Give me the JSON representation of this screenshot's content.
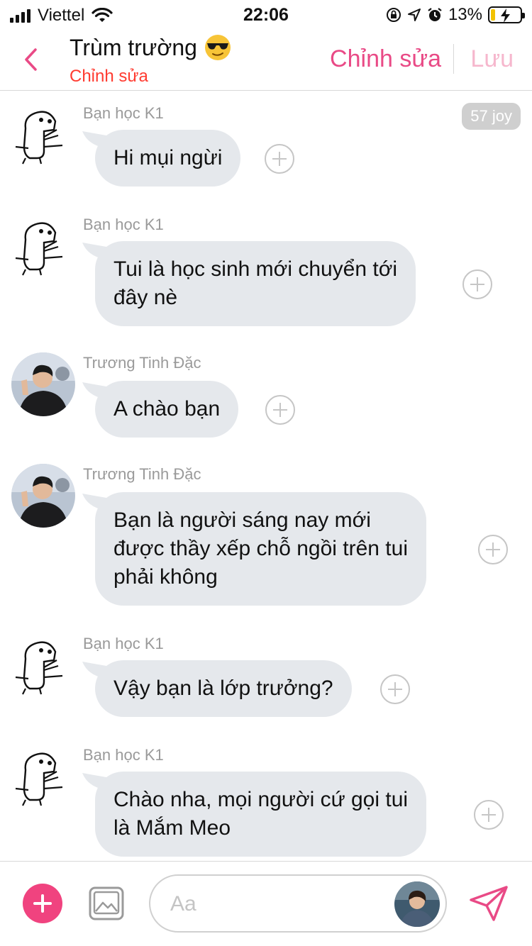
{
  "status_bar": {
    "carrier": "Viettel",
    "time": "22:06",
    "battery_percent": "13%",
    "battery_level": 0.13,
    "icons": [
      "signal-icon",
      "wifi-icon",
      "rotation-lock-icon",
      "location-icon",
      "alarm-icon",
      "battery-icon"
    ]
  },
  "header": {
    "title": "Trùm trường",
    "title_emoji": "sunglasses-emoji",
    "subtitle": "Chỉnh sửa",
    "edit_label": "Chỉnh sửa",
    "save_label": "Lưu"
  },
  "badge": {
    "label": "57 joy"
  },
  "messages": [
    {
      "sender": "Bạn học K1",
      "lines": [
        "Hi mụi ngừi"
      ],
      "avatar": "doodle-avatar"
    },
    {
      "sender": "Bạn học K1",
      "lines": [
        "Tui là học sinh mới chuyển tới",
        "đây nè"
      ],
      "avatar": "doodle-avatar"
    },
    {
      "sender": "Trương Tinh Đặc",
      "lines": [
        "A chào bạn"
      ],
      "avatar": "photo-avatar"
    },
    {
      "sender": "Trương Tinh Đặc",
      "lines": [
        "Bạn là người sáng nay mới",
        "được thầy xếp chỗ ngồi trên tui",
        "phải không"
      ],
      "avatar": "photo-avatar"
    },
    {
      "sender": "Bạn học K1",
      "lines": [
        "Vậy bạn là lớp trưởng?"
      ],
      "avatar": "doodle-avatar"
    },
    {
      "sender": "Bạn học K1",
      "lines": [
        "Chào nha, mọi người cứ gọi tui",
        "là Mắm Meo"
      ],
      "avatar": "doodle-avatar"
    }
  ],
  "composer": {
    "placeholder": "Aa",
    "icons": [
      "add-icon",
      "image-icon",
      "character-avatar",
      "send-icon"
    ]
  },
  "colors": {
    "accent": "#e94a86",
    "accent_light": "#f6b7cd",
    "subtitle": "#ff3b30",
    "bubble": "#e5e8ec",
    "add_button": "#f0437f"
  }
}
